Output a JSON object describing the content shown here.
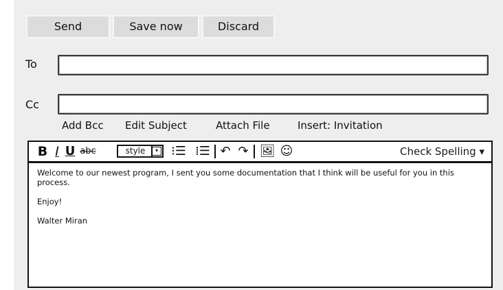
{
  "actions": {
    "send": "Send",
    "save_now": "Save now",
    "discard": "Discard"
  },
  "fields": {
    "to_label": "To",
    "to_value": "",
    "cc_label": "Cc",
    "cc_value": ""
  },
  "links": {
    "add_bcc": "Add Bcc",
    "edit_subject": "Edit Subject",
    "attach_file": "Attach File",
    "insert_invitation": "Insert: Invitation"
  },
  "toolbar": {
    "bold": "B",
    "italic": "I",
    "underline": "U",
    "strikethrough": "abc",
    "style_label": "style",
    "style_arrow": "▾",
    "bulleted_list": "⁝☰",
    "numbered_list": "⁞☰",
    "undo": "↶",
    "redo": "↷",
    "image": "🖼",
    "emoji": "☺",
    "check_spelling": "Check Spelling ▾"
  },
  "message": {
    "line1": "Welcome to our newest program, I sent you some documentation that I think will be useful for you in this process.",
    "line2": "Enjoy!",
    "signature": "Walter Miran"
  },
  "colors": {
    "panel_bg": "#eeeeee",
    "button_bg": "#dcdcdc",
    "border": "#111111"
  }
}
